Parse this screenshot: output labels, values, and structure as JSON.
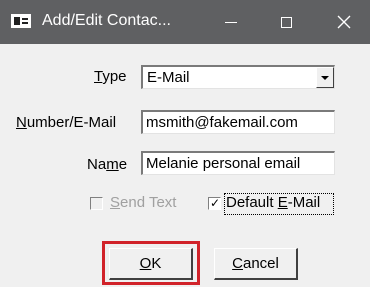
{
  "window": {
    "title": "Add/Edit Contac...",
    "controls": {
      "minimize": "minimize",
      "maximize": "maximize",
      "close": "✕"
    }
  },
  "form": {
    "type": {
      "label_prefix": "",
      "label_mnemonic": "T",
      "label_rest": "ype",
      "value": "E-Mail"
    },
    "number_email": {
      "label_prefix": "",
      "label_mnemonic": "N",
      "label_rest": "umber/E-Mail",
      "value": "msmith@fakemail.com"
    },
    "name": {
      "label_prefix": "Na",
      "label_mnemonic": "m",
      "label_rest": "e",
      "value": "Melanie personal email"
    },
    "send_text": {
      "label_prefix": "",
      "label_mnemonic": "S",
      "label_rest": "end Text",
      "checked": false,
      "disabled": true
    },
    "default_email": {
      "label_prefix": "Default ",
      "label_mnemonic": "E",
      "label_rest": "-Mail",
      "checked": true,
      "check_glyph": "✓"
    }
  },
  "buttons": {
    "ok": {
      "mnemonic": "O",
      "rest": "K"
    },
    "cancel": {
      "mnemonic": "C",
      "rest": "ancel"
    }
  },
  "colors": {
    "titlebar": "#5f6062",
    "highlight": "#d1232a",
    "disabled_text": "#a0a0a0"
  }
}
